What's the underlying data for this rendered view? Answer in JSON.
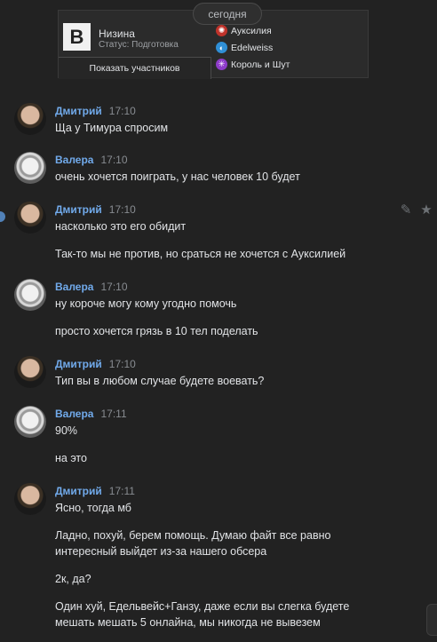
{
  "date_divider": "сегодня",
  "community_card": {
    "logo_letter": "B",
    "name": "Низина",
    "status": "Статус: Подготовка",
    "button": "Показать участников",
    "alliances": [
      {
        "name": "Ауксилия",
        "color": "#c0332b"
      },
      {
        "name": "Edelweiss",
        "color": "#2f8fd6"
      },
      {
        "name": "Король и Шут",
        "color": "#8e3cc9"
      }
    ]
  },
  "messages": [
    {
      "author": "Дмитрий",
      "time": "17:10",
      "avatar": "dmitry-avatar",
      "lines": [
        "Ща у Тимура спросим"
      ]
    },
    {
      "author": "Валера",
      "time": "17:10",
      "avatar": "valera-avatar",
      "lines": [
        "очень хочется поиграть, у нас человек 10 будет"
      ]
    },
    {
      "author": "Дмитрий",
      "time": "17:10",
      "avatar": "dmitry-avatar",
      "lines": [
        "насколько это его обидит",
        "Так-то мы не против, но сраться не хочется с Ауксилией"
      ]
    },
    {
      "author": "Валера",
      "time": "17:10",
      "avatar": "valera-avatar",
      "lines": [
        "ну короче могу кому угодно помочь",
        "просто хочется грязь в 10 тел поделать"
      ]
    },
    {
      "author": "Дмитрий",
      "time": "17:10",
      "avatar": "dmitry-avatar",
      "lines": [
        "Тип вы в любом случае будете воевать?"
      ]
    },
    {
      "author": "Валера",
      "time": "17:11",
      "avatar": "valera-avatar",
      "lines": [
        "90%",
        "на это"
      ]
    },
    {
      "author": "Дмитрий",
      "time": "17:11",
      "avatar": "dmitry-avatar",
      "lines": [
        "Ясно, тогда мб",
        "Ладно, похуй, берем помощь. Думаю файт все равно",
        "интересный выйдет из-за нашего обсера",
        "2к, да?",
        "Один хуй, Едельвейс+Ганзу, даже если вы слегка будете",
        "мешать мешать 5 онлайна, мы никогда не вывезем"
      ]
    }
  ],
  "actions": {
    "edit_icon": "pencil-icon",
    "favorite_icon": "star-icon"
  }
}
